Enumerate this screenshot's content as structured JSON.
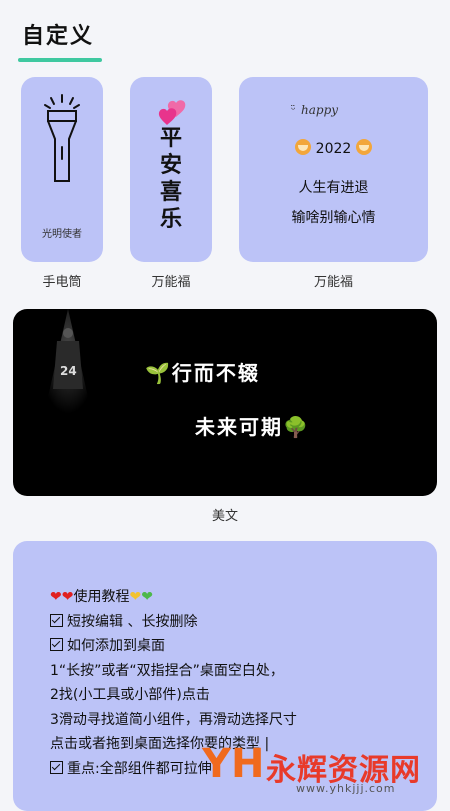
{
  "header": {
    "tab_label": "自定义",
    "accent_color": "#3fc8a0"
  },
  "widgets": [
    {
      "name": "手电筒",
      "caption": "光明使者",
      "icon": "flashlight-icon"
    },
    {
      "name": "万能福",
      "text_lines": [
        "平",
        "安",
        "喜",
        "乐"
      ],
      "icon": "heart-icon"
    },
    {
      "name": "万能福",
      "happy": "happy",
      "year_line": "2022",
      "line1": "人生有进退",
      "line2": "输啥别输心情",
      "icon": "tiger-icon"
    }
  ],
  "quote_widget": {
    "name": "美文",
    "line1": "行而不辍",
    "line2": "未来可期",
    "icons": [
      "seedling-icon",
      "tree-icon"
    ]
  },
  "guide": {
    "title": "使用教程",
    "items": [
      "短按编辑 、长按删除",
      "如何添加到桌面",
      "1“长按”或者“双指捏合”桌面空白处，",
      "2找(小工具或小部件)点击",
      "3滑动寻找道简小组件，再滑动选择尺寸",
      "点击或者拖到桌面选择你要的类型 |",
      "重点:全部组件都可拉伸 |"
    ]
  },
  "watermark": {
    "brand": "永辉资源网",
    "url": "www.yhkjjj.com"
  },
  "colors": {
    "card_bg": "#bcc3f7",
    "page_bg": "#f4f5f9",
    "quote_bg": "#000000"
  }
}
